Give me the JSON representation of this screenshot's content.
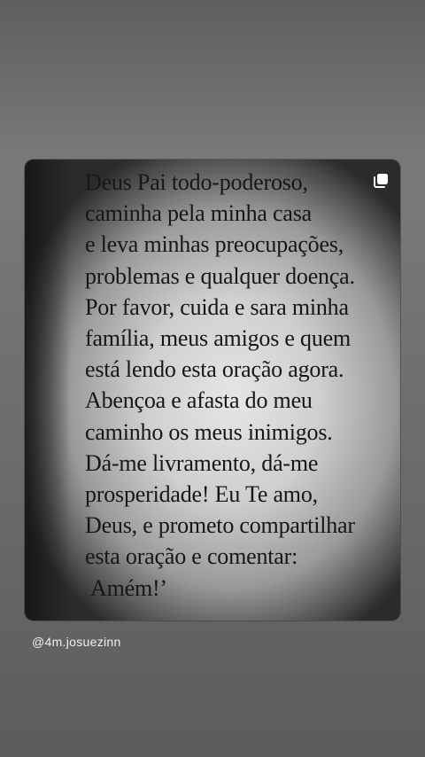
{
  "post": {
    "lines": [
      "Deus Pai todo-poderoso,",
      "caminha pela minha casa",
      "e leva minhas preocupações,",
      "problemas e qualquer doença.",
      "Por favor, cuida e sara minha",
      "família, meus amigos e quem",
      "está lendo esta oração agora.",
      "Abençoa e afasta do meu",
      "caminho os meus inimigos.",
      "Dá-me livramento, dá-me",
      "prosperidade! Eu Te amo,",
      "Deus, e prometo compartilhar",
      "esta oração e comentar:",
      "Amém!’"
    ],
    "corner_icon": "multiple-posts-icon"
  },
  "story": {
    "mention": "@4m.josuezinn"
  }
}
